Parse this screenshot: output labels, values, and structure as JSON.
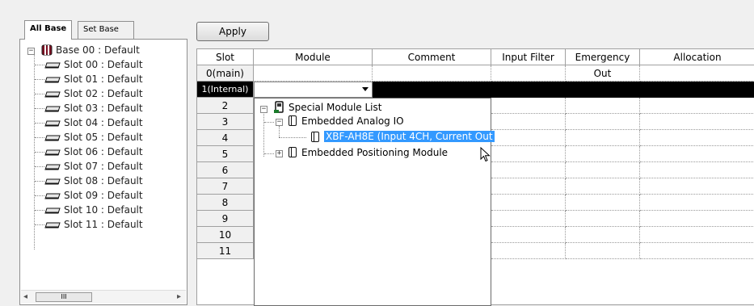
{
  "tabs": [
    {
      "label": "All Base",
      "active": true
    },
    {
      "label": "Set Base",
      "active": false
    }
  ],
  "tree": {
    "base": "Base 00 : Default",
    "slots": [
      "Slot 00 : Default",
      "Slot 01 : Default",
      "Slot 02 : Default",
      "Slot 03 : Default",
      "Slot 04 : Default",
      "Slot 05 : Default",
      "Slot 06 : Default",
      "Slot 07 : Default",
      "Slot 08 : Default",
      "Slot 09 : Default",
      "Slot 10 : Default",
      "Slot 11 : Default"
    ],
    "selected_slot": "Slot 01 : Default",
    "scroll_thumb": "III"
  },
  "apply_label": "Apply",
  "grid": {
    "columns": [
      "Slot",
      "Module",
      "Comment",
      "Input Filter",
      "Emergency Out",
      "Allocation"
    ],
    "rows": [
      "0(main)",
      "1(Internal)",
      "2",
      "3",
      "4",
      "5",
      "6",
      "7",
      "8",
      "9",
      "10",
      "11"
    ],
    "selected_row": "1(Internal)"
  },
  "popup": {
    "root": "Special Module List",
    "group1": "Embedded Analog IO",
    "item": "XBF-AH8E (Input 4CH, Current Out",
    "group2": "Embedded Positioning Module"
  },
  "colors": {
    "highlight": "#3399ff",
    "selected_row": "#000000"
  }
}
